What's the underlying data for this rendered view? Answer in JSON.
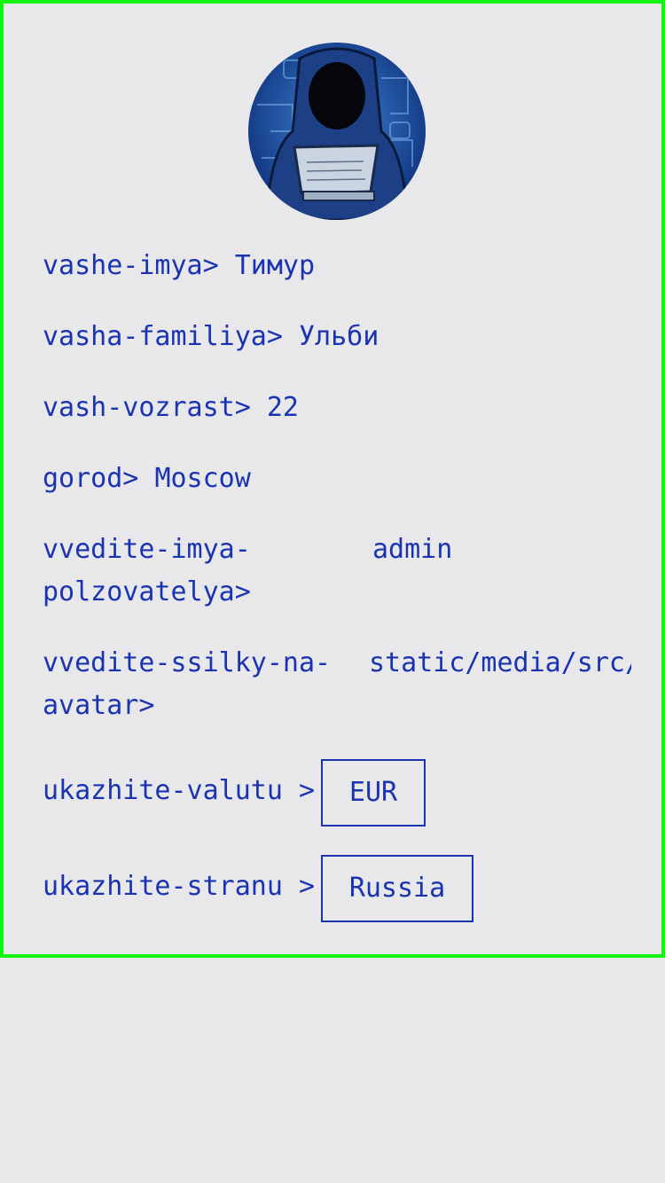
{
  "profile": {
    "avatar_alt": "hacker-avatar",
    "fields": [
      {
        "label": "vashe-imya>",
        "value": "Тимур"
      },
      {
        "label": "vasha-familiya>",
        "value": "Ульби"
      },
      {
        "label": "vash-vozrast>",
        "value": "22"
      },
      {
        "label": "gorod>",
        "value": "Moscow"
      }
    ],
    "username": {
      "label": "vvedite-imya-polzovatelya>",
      "label_line1": "vvedite-imya-",
      "label_line2": "polzovatelya>",
      "value": "admin"
    },
    "avatar_link": {
      "label_line1": "vvedite-ssilky-na-",
      "label_line2": "avatar>",
      "value": "static/media/src/avatar.jpg"
    },
    "currency": {
      "label": "ukazhite-valutu >",
      "selected": "EUR"
    },
    "country": {
      "label": "ukazhite-stranu >",
      "selected": "Russia"
    }
  },
  "colors": {
    "accent": "#1a33b0",
    "border": "#12f512",
    "background": "#e8e7ea"
  }
}
